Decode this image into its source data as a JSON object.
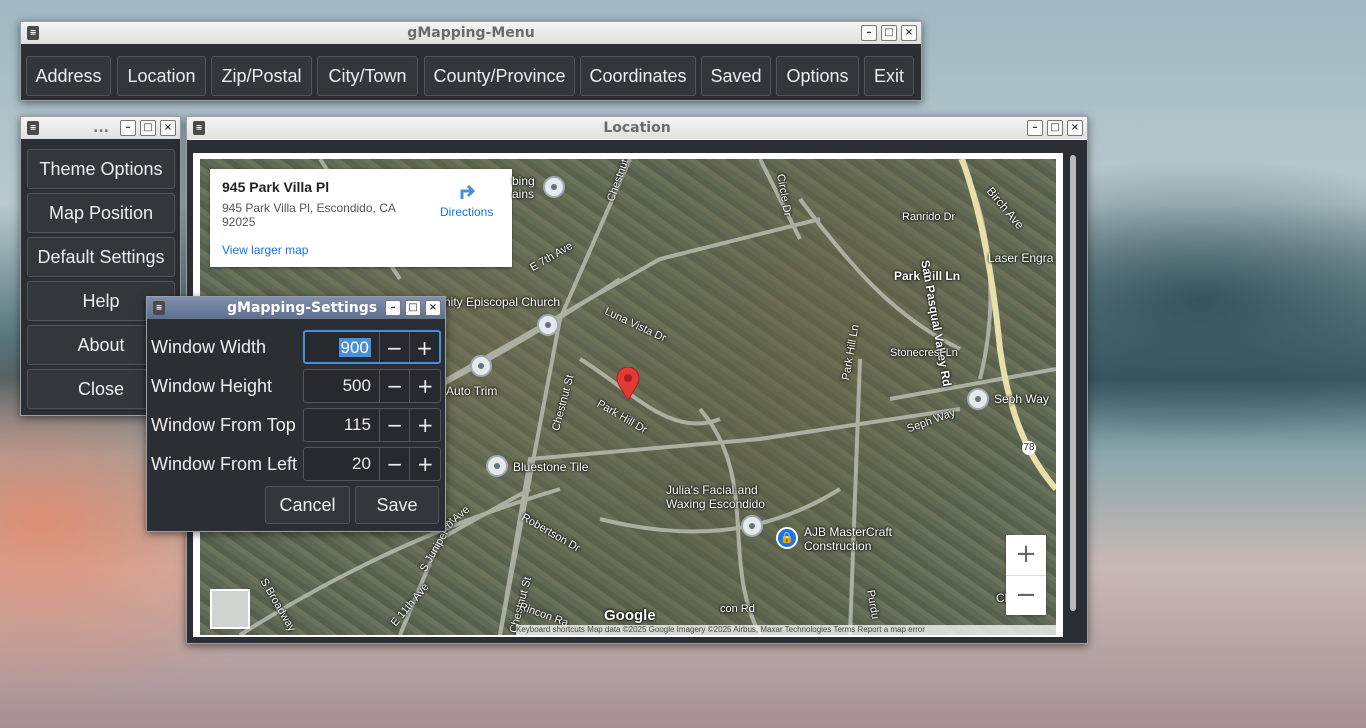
{
  "menu": {
    "title": "gMapping-Menu",
    "buttons": [
      "Address",
      "Location",
      "Zip/Postal",
      "City/Town",
      "County/Province",
      "Coordinates",
      "Saved",
      "Options",
      "Exit"
    ]
  },
  "side": {
    "title": "...",
    "buttons": [
      "Theme Options",
      "Map Position",
      "Default Settings",
      "Help",
      "About",
      "Close"
    ]
  },
  "location": {
    "title": "Location",
    "card": {
      "name": "945 Park Villa Pl",
      "address": "945 Park Villa Pl, Escondido, CA 92025",
      "directions": "Directions",
      "larger_map": "View larger map"
    },
    "labels": {
      "church": "nity Episcopal Church",
      "bing": "bing\nains",
      "chestnut": "Chestnut St",
      "chestnut2": "Chestnut St",
      "chestnut3": "Chestnut St",
      "e7th": "E 7th Ave",
      "luna": "Luna Vista Dr",
      "parkhill": "Park Hill Dr",
      "autotrim": "Auto Trim",
      "bluestone": "Bluestone Tile",
      "julia": "Julia's Facial and\nWaxing Escondido",
      "ajb": "AJB MasterCraft\nConstruction",
      "robertson": "Robertson Dr",
      "sjuniper": "S Juniper St",
      "e11th": "E 11th Ave",
      "sbroadway": "S Broadway",
      "rincon": "Rincon Ra",
      "ranrido": "Ranrido Dr",
      "parkhillln": "Park Hill Ln",
      "laser": "Laser Engra",
      "sanpasqual": "San Pasqual Valley Rd",
      "stonecrest": "Stonecrest Ln",
      "sephway": "Seph Way",
      "sephway2": "Seph Way",
      "parkhillln2": "Park Hill Ln",
      "birch": "Birch Ave",
      "circle": "Circle Dr",
      "christian": "E\nChristian",
      "google": "Google",
      "attribution": "Keyboard shortcuts   Map data ©2025 Google Imagery ©2025 Airbus, Maxar Technologies   Terms   Report a map error",
      "route78": "78",
      "purdue": "Purdu",
      "ocon": "con Rd",
      "avenue": "n Ave"
    },
    "zoom_in": "+",
    "zoom_out": "−"
  },
  "settings": {
    "title": "gMapping-Settings",
    "rows": [
      {
        "label": "Window Width",
        "value": "900"
      },
      {
        "label": "Window Height",
        "value": "500"
      },
      {
        "label": "Window From Top",
        "value": "115"
      },
      {
        "label": "Window From Left",
        "value": "20"
      }
    ],
    "minus": "−",
    "plus": "+",
    "cancel": "Cancel",
    "save": "Save"
  }
}
